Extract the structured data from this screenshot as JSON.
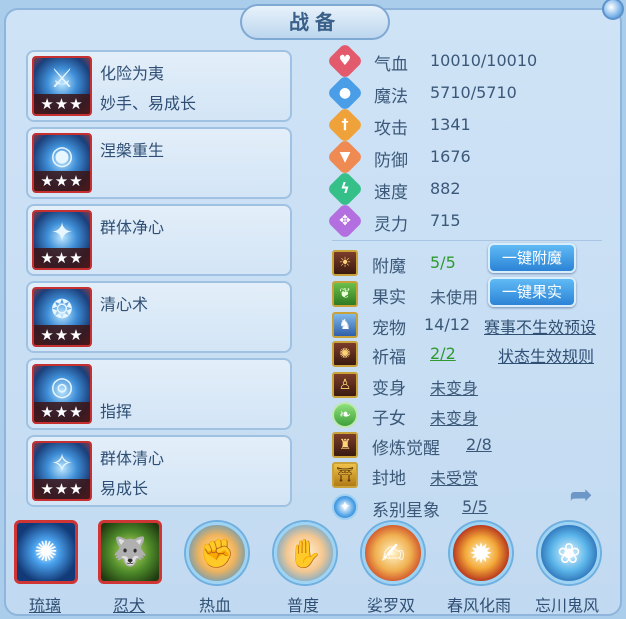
{
  "title": "战备",
  "skills": [
    {
      "name": "化险为夷",
      "sub": "妙手、易成长",
      "stars": "★★★",
      "glyph": "⚔"
    },
    {
      "name": "涅槃重生",
      "sub": "",
      "stars": "★★★",
      "glyph": "◉"
    },
    {
      "name": "群体净心",
      "sub": "",
      "stars": "★★★",
      "glyph": "✦"
    },
    {
      "name": "清心术",
      "sub": "",
      "stars": "★★★",
      "glyph": "❂"
    },
    {
      "name": "",
      "sub": "指挥",
      "stars": "★★★",
      "glyph": "◎"
    },
    {
      "name": "群体清心",
      "sub": "易成长",
      "stars": "★★★",
      "glyph": "✧"
    }
  ],
  "stats": [
    {
      "label": "气血",
      "value": "10010/10010",
      "icon": "heart-icon",
      "color": "#e25a6c",
      "glyph": "♥"
    },
    {
      "label": "魔法",
      "value": "5710/5710",
      "icon": "mana-icon",
      "color": "#4a9ee8",
      "glyph": "●"
    },
    {
      "label": "攻击",
      "value": "1341",
      "icon": "sword-icon",
      "color": "#f0a23a",
      "glyph": "†"
    },
    {
      "label": "防御",
      "value": "1676",
      "icon": "shield-icon",
      "color": "#ee8a52",
      "glyph": "▼"
    },
    {
      "label": "速度",
      "value": "882",
      "icon": "lightning-icon",
      "color": "#35c08a",
      "glyph": "ϟ"
    },
    {
      "label": "灵力",
      "value": "715",
      "icon": "spirit-icon",
      "color": "#b36ee0",
      "glyph": "✥"
    }
  ],
  "rows": {
    "enchant": {
      "label": "附魔",
      "value": "5/5",
      "button": "一键附魔"
    },
    "fruit": {
      "label": "果实",
      "value": "未使用",
      "button": "一键果实"
    },
    "pet": {
      "label": "宠物",
      "value": "14/12",
      "link": "赛事不生效预设"
    },
    "blessing": {
      "label": "祈福",
      "value": "2/2",
      "link": "状态生效规则"
    },
    "transform": {
      "label": "变身",
      "value": "未变身"
    },
    "child": {
      "label": "子女",
      "value": "未变身"
    },
    "cultivation": {
      "label": "修炼觉醒",
      "value": "2/8"
    },
    "title_land": {
      "label": "封地",
      "value": "未受赏"
    },
    "stars": {
      "label": "系别星象",
      "value": "5/5"
    }
  },
  "bottom": [
    {
      "label": "琉璃",
      "glyph": "✺"
    },
    {
      "label": "忍犬",
      "glyph": "🐺"
    },
    {
      "label": "热血",
      "glyph": "✊"
    },
    {
      "label": "普度",
      "glyph": "✋"
    },
    {
      "label": "娑罗双",
      "glyph": "✍"
    },
    {
      "label": "春风化雨",
      "glyph": "✹"
    },
    {
      "label": "忘川鬼风",
      "glyph": "❀"
    }
  ],
  "icons": {
    "share": "share-icon"
  }
}
